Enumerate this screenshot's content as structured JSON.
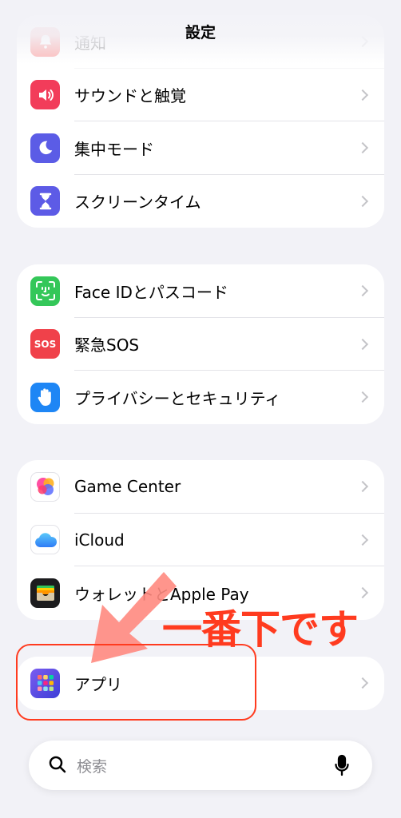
{
  "nav": {
    "title": "設定"
  },
  "groups": [
    {
      "items": [
        {
          "label": "通知",
          "icon": "bell-icon",
          "color": "#f53b3b",
          "faded": true
        },
        {
          "label": "サウンドと触覚",
          "icon": "speaker-icon",
          "color": "#f23c5a"
        },
        {
          "label": "集中モード",
          "icon": "moon-icon",
          "color": "#5b5ce6"
        },
        {
          "label": "スクリーンタイム",
          "icon": "hourglass-icon",
          "color": "#5d5be6"
        }
      ]
    },
    {
      "items": [
        {
          "label": "Face IDとパスコード",
          "icon": "face-id-icon",
          "color": "#34c759"
        },
        {
          "label": "緊急SOS",
          "icon": "sos-icon",
          "color": "#f0414a",
          "icon_text": "SOS"
        },
        {
          "label": "プライバシーとセキュリティ",
          "icon": "hand-icon",
          "color": "#1e86f5"
        }
      ]
    },
    {
      "items": [
        {
          "label": "Game Center",
          "icon": "game-center-icon",
          "color": "#ffffff"
        },
        {
          "label": "iCloud",
          "icon": "cloud-icon",
          "color": "#ffffff"
        },
        {
          "label": "ウォレットとApple Pay",
          "icon": "wallet-icon",
          "color": "#1c1c1e"
        }
      ]
    },
    {
      "items": [
        {
          "label": "アプリ",
          "icon": "apps-grid-icon",
          "color": "#5e4bdb"
        }
      ]
    }
  ],
  "search": {
    "placeholder": "検索"
  },
  "annotation": {
    "text": "一番下です",
    "color": "#ff3b1f"
  }
}
